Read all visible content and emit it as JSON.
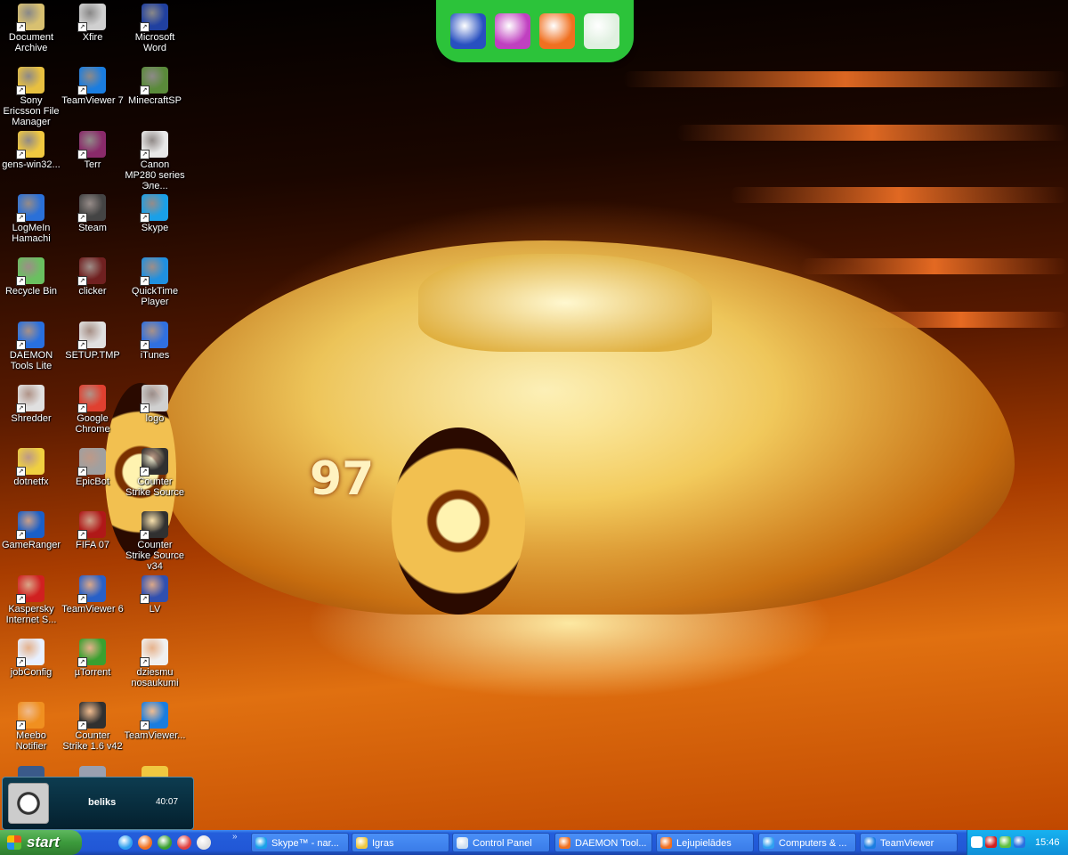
{
  "desktop_icons": [
    {
      "label": "Document Archive",
      "icon": "cabinet-icon",
      "color": "#d8c070"
    },
    {
      "label": "Sony Ericsson File Manager",
      "icon": "phone-folder-icon",
      "color": "#e8c040"
    },
    {
      "label": "gens-win32...",
      "icon": "folder-icon",
      "color": "#f0c840"
    },
    {
      "label": "LogMeIn Hamachi",
      "icon": "hamachi-icon",
      "color": "#2a70d8"
    },
    {
      "label": "Recycle Bin",
      "icon": "recycle-bin-icon",
      "color": "#6ac060"
    },
    {
      "label": "DAEMON Tools Lite",
      "icon": "daemon-tools-icon",
      "color": "#2870e0"
    },
    {
      "label": "Shredder",
      "icon": "shredder-icon",
      "color": "#e0e0e0"
    },
    {
      "label": "dotnetfx",
      "icon": "installer-icon",
      "color": "#f0d040"
    },
    {
      "label": "GameRanger",
      "icon": "gameranger-icon",
      "color": "#1a5fc8"
    },
    {
      "label": "Kaspersky Internet S...",
      "icon": "kaspersky-icon",
      "color": "#d02020"
    },
    {
      "label": "jobConfig",
      "icon": "document-icon",
      "color": "#e8f0ff"
    },
    {
      "label": "Meebo Notifier",
      "icon": "meebo-icon",
      "color": "#f09020"
    },
    {
      "label": "Xfire",
      "icon": "xfire-icon",
      "color": "#d0d0d0"
    },
    {
      "label": "TeamViewer 7",
      "icon": "teamviewer-icon",
      "color": "#1a7de0"
    },
    {
      "label": "Terr",
      "icon": "winrar-icon",
      "color": "#8a2a6a"
    },
    {
      "label": "Steam",
      "icon": "steam-icon",
      "color": "#444444"
    },
    {
      "label": "clicker",
      "icon": "clicker-icon",
      "color": "#702020"
    },
    {
      "label": "SETUP.TMP",
      "icon": "tmp-file-icon",
      "color": "#e0e0e0"
    },
    {
      "label": "Google Chrome",
      "icon": "chrome-icon",
      "color": "#e04030"
    },
    {
      "label": "EpicBot",
      "icon": "epicbot-icon",
      "color": "#a0a0a0"
    },
    {
      "label": "FIFA 07",
      "icon": "fifa-icon",
      "color": "#b01818"
    },
    {
      "label": "TeamViewer 6",
      "icon": "window-icon",
      "color": "#2860c8"
    },
    {
      "label": "µTorrent",
      "icon": "utorrent-icon",
      "color": "#3aa030"
    },
    {
      "label": "Counter Strike 1.6 v42",
      "icon": "counter-strike-icon",
      "color": "#303030"
    },
    {
      "label": "Microsoft Word",
      "icon": "word-icon",
      "color": "#2040a0"
    },
    {
      "label": "MinecraftSP",
      "icon": "minecraft-icon",
      "color": "#5a8a3a"
    },
    {
      "label": "Canon MP280 series Эле...",
      "icon": "printer-help-icon",
      "color": "#e8e8e8"
    },
    {
      "label": "Skype",
      "icon": "skype-icon",
      "color": "#1aa0e8"
    },
    {
      "label": "QuickTime Player",
      "icon": "quicktime-icon",
      "color": "#2090e0"
    },
    {
      "label": "iTunes",
      "icon": "itunes-icon",
      "color": "#3070e0"
    },
    {
      "label": "logo",
      "icon": "image-file-icon",
      "color": "#d0d0d0"
    },
    {
      "label": "Counter Strike Source",
      "icon": "counter-strike-icon",
      "color": "#303030"
    },
    {
      "label": "Counter Strike Source v34",
      "icon": "counter-strike-icon",
      "color": "#303030"
    },
    {
      "label": "LV",
      "icon": "word-doc-icon",
      "color": "#3050b0"
    },
    {
      "label": "dziesmu nosaukumi",
      "icon": "text-file-icon",
      "color": "#f0f0f0"
    },
    {
      "label": "TeamViewer...",
      "icon": "teamviewer-icon",
      "color": "#1a7de0"
    }
  ],
  "partial_icons": [
    {
      "icon": "partial-app-icon",
      "color": "#3a5a8a"
    },
    {
      "icon": "partial-window-icon",
      "color": "#9aa0b0"
    },
    {
      "icon": "folder-icon",
      "color": "#f0c840"
    }
  ],
  "dock": [
    {
      "icon": "my-computer-icon",
      "color": "#2850c0"
    },
    {
      "icon": "media-icon",
      "color": "#c040c0"
    },
    {
      "icon": "browser-icon",
      "color": "#f07020"
    },
    {
      "icon": "recycle-icon",
      "color": "#e0f0e0"
    }
  ],
  "notification": {
    "name": "beliks",
    "time": "40:07"
  },
  "taskbar": {
    "start_label": "start",
    "quick_launch": [
      {
        "icon": "ie-icon",
        "color": "#30a0f0"
      },
      {
        "icon": "firefox-icon",
        "color": "#f07020"
      },
      {
        "icon": "utorrent-icon",
        "color": "#3aa030"
      },
      {
        "icon": "game-icon",
        "color": "#e04040"
      },
      {
        "icon": "desktop-icon",
        "color": "#e0e0e0"
      }
    ],
    "overflow": "»",
    "tasks": [
      {
        "label": "Skype™ - nar...",
        "icon": "skype-icon",
        "color": "#1aa0e8"
      },
      {
        "label": "Igras",
        "icon": "folder-icon",
        "color": "#f0c840"
      },
      {
        "label": "Control Panel",
        "icon": "control-panel-icon",
        "color": "#d0e0f0"
      },
      {
        "label": "DAEMON Tool...",
        "icon": "firefox-icon",
        "color": "#f07020"
      },
      {
        "label": "Lejupielādes",
        "icon": "firefox-icon",
        "color": "#f07020"
      },
      {
        "label": "Computers & ...",
        "icon": "ie-icon",
        "color": "#30a0f0"
      },
      {
        "label": "TeamViewer",
        "icon": "teamviewer-icon",
        "color": "#1a7de0"
      }
    ],
    "tray": [
      {
        "icon": "tray-chevron-icon",
        "color": "#ffffff"
      },
      {
        "icon": "kaspersky-tray-icon",
        "color": "#d02020"
      },
      {
        "icon": "shield-tray-icon",
        "color": "#60c040"
      },
      {
        "icon": "daemon-tray-icon",
        "color": "#2870e0"
      }
    ],
    "clock": "15:46"
  }
}
